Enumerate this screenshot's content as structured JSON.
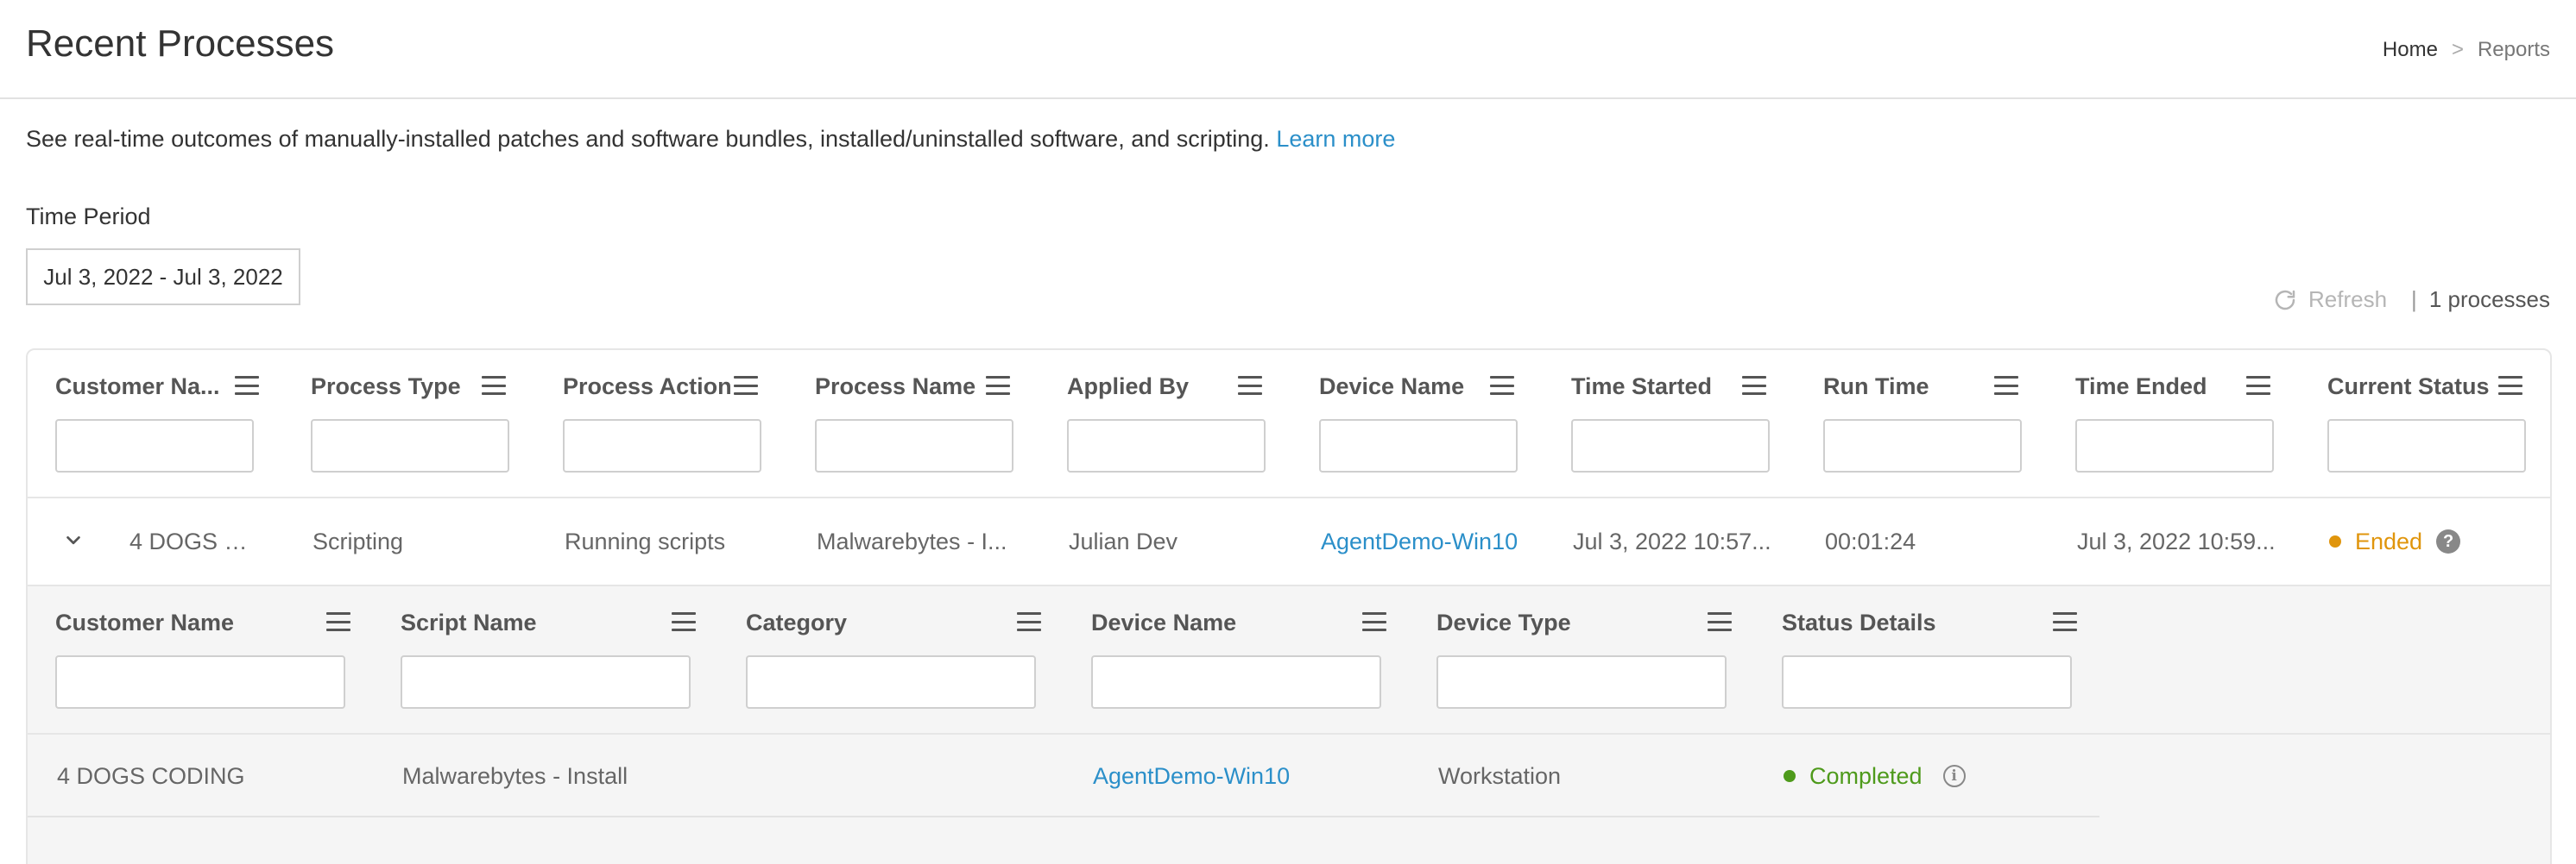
{
  "header": {
    "title": "Recent Processes",
    "breadcrumb": {
      "home": "Home",
      "separator": ">",
      "current": "Reports"
    }
  },
  "description": {
    "text": "See real-time outcomes of manually-installed patches and software bundles, installed/uninstalled software, and scripting.",
    "link": "Learn more"
  },
  "time_period": {
    "label": "Time Period",
    "value": "Jul 3, 2022 - Jul 3, 2022"
  },
  "toolbar": {
    "refresh_label": "Refresh",
    "divider": "|",
    "count_label": "1 processes"
  },
  "colors": {
    "accent_link": "#2b8fc9",
    "status_ended": "#e0950c",
    "status_completed": "#4e9a1b"
  },
  "main_table": {
    "columns": [
      "Customer Na...",
      "Process Type",
      "Process Action",
      "Process Name",
      "Applied By",
      "Device Name",
      "Time Started",
      "Run Time",
      "Time Ended",
      "Current Status"
    ],
    "rows": [
      {
        "customer": "4 DOGS C...",
        "process_type": "Scripting",
        "process_action": "Running scripts",
        "process_name": "Malwarebytes - I...",
        "applied_by": "Julian Dev",
        "device_name": "AgentDemo-Win10",
        "time_started": "Jul 3, 2022 10:57...",
        "run_time": "00:01:24",
        "time_ended": "Jul 3, 2022 10:59...",
        "status": "Ended",
        "status_help": "?"
      }
    ]
  },
  "sub_table": {
    "columns": [
      "Customer Name",
      "Script Name",
      "Category",
      "Device Name",
      "Device Type",
      "Status Details"
    ],
    "rows": [
      {
        "customer": "4 DOGS CODING",
        "script_name": "Malwarebytes - Install",
        "category": "",
        "device_name": "AgentDemo-Win10",
        "device_type": "Workstation",
        "status": "Completed",
        "status_info": "i"
      }
    ]
  }
}
